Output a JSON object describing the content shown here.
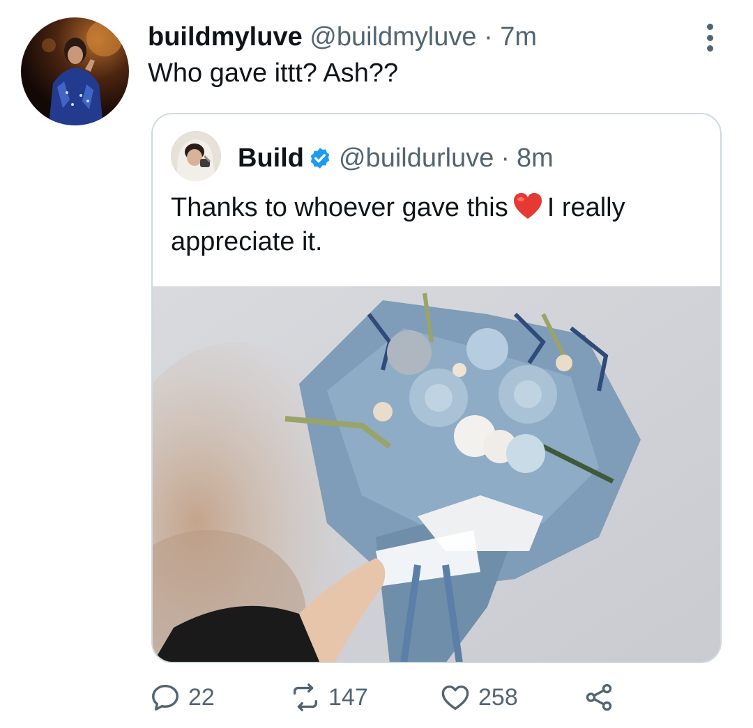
{
  "tweet": {
    "display_name": "buildmyluve",
    "handle": "@buildmyluve",
    "separator": "·",
    "time": "7m",
    "text": "Who gave ittt? Ash??"
  },
  "quoted_tweet": {
    "display_name": "Build",
    "verified": true,
    "handle": "@buildurluve",
    "separator": "·",
    "time": "8m",
    "text_part1": "Thanks to whoever gave this",
    "emoji": "red-heart",
    "text_part2": "I really appreciate it."
  },
  "actions": {
    "reply_count": "22",
    "retweet_count": "147",
    "like_count": "258"
  },
  "colors": {
    "text_primary": "#0f1419",
    "text_secondary": "#536471",
    "border": "#cfd9de",
    "verified_blue": "#1d9bf0",
    "heart_red": "#e0245e"
  },
  "icons": [
    "more-vertical-icon",
    "verified-badge-icon",
    "reply-icon",
    "retweet-icon",
    "like-icon",
    "share-icon"
  ]
}
